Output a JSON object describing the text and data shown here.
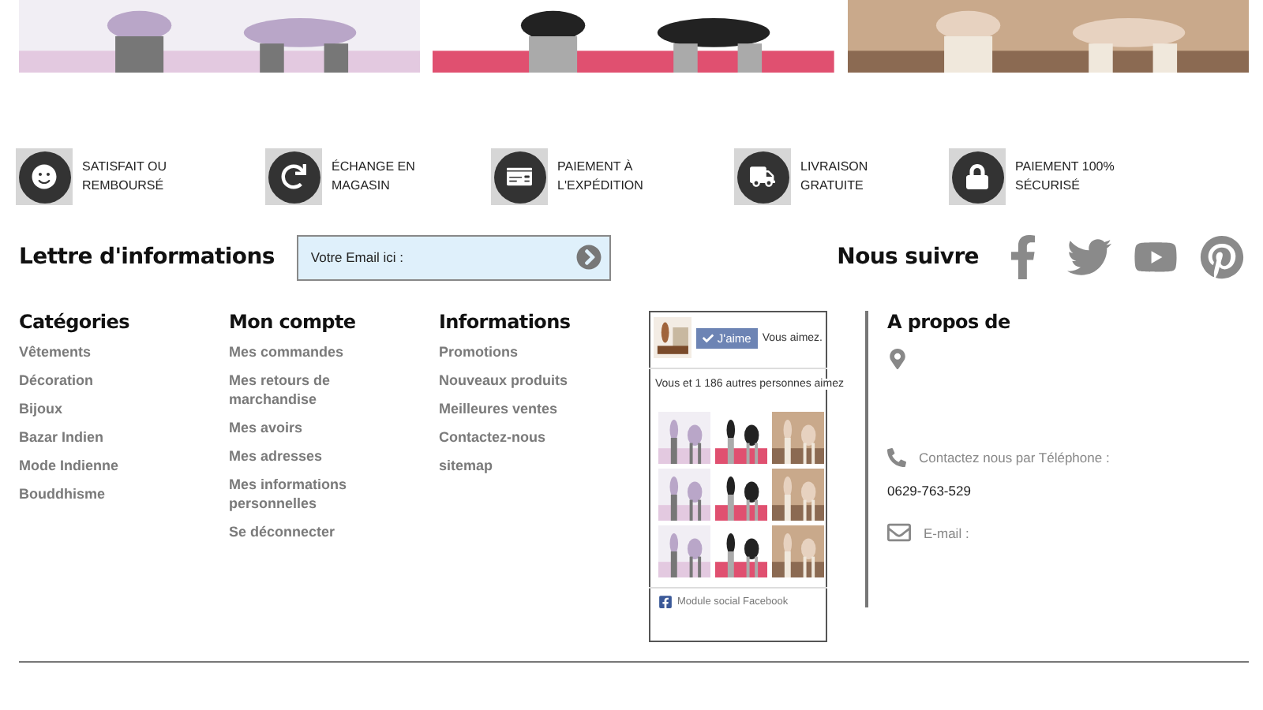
{
  "features": [
    {
      "kind": "smile",
      "label": "SATISFAIT OU\nREMBOURSÉ"
    },
    {
      "kind": "exchange",
      "label": "ÉCHANGE EN\nMAGASIN"
    },
    {
      "kind": "payment",
      "label": "PAIEMENT À\nL'EXPÉDITION"
    },
    {
      "kind": "delivery",
      "label": "LIVRAISON\nGRATUITE"
    },
    {
      "kind": "secure",
      "label": "PAIEMENT 100%\nSÉCURISÉ"
    }
  ],
  "newsletter": {
    "title": "Lettre d'informations",
    "placeholder": "Votre Email ici :"
  },
  "follow": {
    "title": "Nous suivre",
    "networks": [
      {
        "kind": "facebook"
      },
      {
        "kind": "twitter"
      },
      {
        "kind": "youtube"
      },
      {
        "kind": "pinterest"
      }
    ]
  },
  "columns": [
    {
      "title": "Catégories",
      "links": [
        "Vêtements",
        "Décoration",
        "Bijoux",
        "Bazar Indien",
        "Mode Indienne",
        "Bouddhisme"
      ]
    },
    {
      "title": "Mon compte",
      "links": [
        "Mes commandes",
        "Mes retours de marchandise",
        "Mes avoirs",
        "Mes adresses",
        "Mes informations personnelles",
        "Se déconnecter"
      ]
    },
    {
      "title": "Informations",
      "links": [
        "Promotions",
        "Nouveaux produits",
        "Meilleures ventes",
        "Contactez-nous",
        "sitemap"
      ]
    }
  ],
  "facebook": {
    "like_button": "J'aime",
    "like_text": "Vous aimez.",
    "friends_text": "Vous et 1 186 autres personnes aimez",
    "footer": "Module social Facebook"
  },
  "about": {
    "title": "A propos de",
    "phone_label": "Contactez nous par Téléphone :",
    "phone": "0629-763-529",
    "email_label": "E-mail :"
  }
}
